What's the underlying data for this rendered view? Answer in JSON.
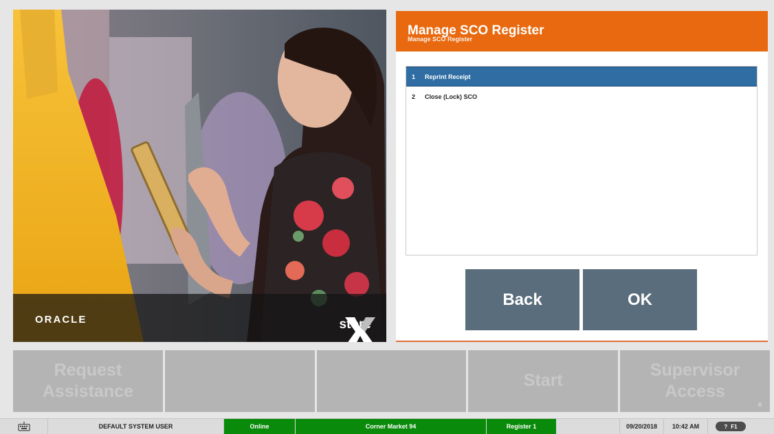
{
  "brand": {
    "oracle_text": "ORACLE",
    "xstore_text": "store"
  },
  "dialog": {
    "title": "Manage SCO Register",
    "subtitle": "Manage SCO Register",
    "items": [
      {
        "num": "1",
        "label": "Reprint Receipt",
        "selected": true
      },
      {
        "num": "2",
        "label": "Close (Lock) SCO",
        "selected": false
      }
    ],
    "back_label": "Back",
    "ok_label": "OK"
  },
  "actions": {
    "request_assistance": "Request Assistance",
    "blank_1": "",
    "blank_2": "",
    "start": "Start",
    "supervisor_access": "Supervisor Access"
  },
  "status": {
    "user": "DEFAULT SYSTEM USER",
    "online": "Online",
    "store": "Corner Market 94",
    "register": "Register 1",
    "date": "09/20/2018",
    "time": "10:42 AM",
    "help_q": "?",
    "help_key": "F1"
  },
  "colors": {
    "header": "#e8690f",
    "selected_row": "#2f6da3",
    "button": "#5a6d7c",
    "status_green": "#0a8a0a"
  },
  "icons": {
    "keyboard": "keyboard-icon",
    "xstore_logo": "xstore-x-logo"
  }
}
